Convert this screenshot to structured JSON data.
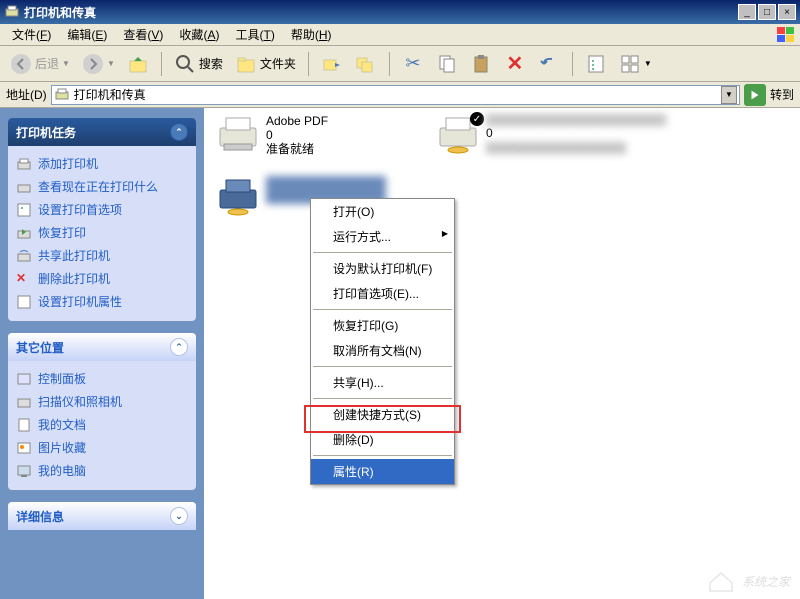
{
  "window": {
    "title": "打印机和传真",
    "buttons": {
      "min": "_",
      "max": "□",
      "close": "×"
    }
  },
  "menubar": {
    "items": [
      {
        "label": "文件",
        "key": "F"
      },
      {
        "label": "编辑",
        "key": "E"
      },
      {
        "label": "查看",
        "key": "V"
      },
      {
        "label": "收藏",
        "key": "A"
      },
      {
        "label": "工具",
        "key": "T"
      },
      {
        "label": "帮助",
        "key": "H"
      }
    ]
  },
  "toolbar": {
    "back": "后退",
    "search": "搜索",
    "folders": "文件夹"
  },
  "addressbar": {
    "label": "地址(D)",
    "value": "打印机和传真",
    "go": "转到"
  },
  "sidebar": {
    "panel1": {
      "title": "打印机任务",
      "tasks": [
        "添加打印机",
        "查看现在正在打印什么",
        "设置打印首选项",
        "恢复打印",
        "共享此打印机",
        "删除此打印机",
        "设置打印机属性"
      ]
    },
    "panel2": {
      "title": "其它位置",
      "tasks": [
        "控制面板",
        "扫描仪和照相机",
        "我的文档",
        "图片收藏",
        "我的电脑"
      ]
    },
    "panel3": {
      "title": "详细信息"
    }
  },
  "printers": {
    "p1": {
      "name": "Adobe PDF",
      "jobs": "0",
      "status": "准备就绪"
    },
    "p2": {
      "jobs": "0"
    }
  },
  "context_menu": {
    "items": [
      {
        "label": "打开(O)",
        "type": "item"
      },
      {
        "label": "运行方式...",
        "type": "submenu"
      },
      {
        "type": "sep"
      },
      {
        "label": "设为默认打印机(F)",
        "type": "item"
      },
      {
        "label": "打印首选项(E)...",
        "type": "item"
      },
      {
        "type": "sep"
      },
      {
        "label": "恢复打印(G)",
        "type": "item"
      },
      {
        "label": "取消所有文档(N)",
        "type": "item"
      },
      {
        "type": "sep"
      },
      {
        "label": "共享(H)...",
        "type": "item"
      },
      {
        "type": "sep"
      },
      {
        "label": "创建快捷方式(S)",
        "type": "item"
      },
      {
        "label": "删除(D)",
        "type": "item"
      },
      {
        "type": "sep"
      },
      {
        "label": "属性(R)",
        "type": "item",
        "selected": true
      }
    ]
  },
  "watermark": "系统之家"
}
